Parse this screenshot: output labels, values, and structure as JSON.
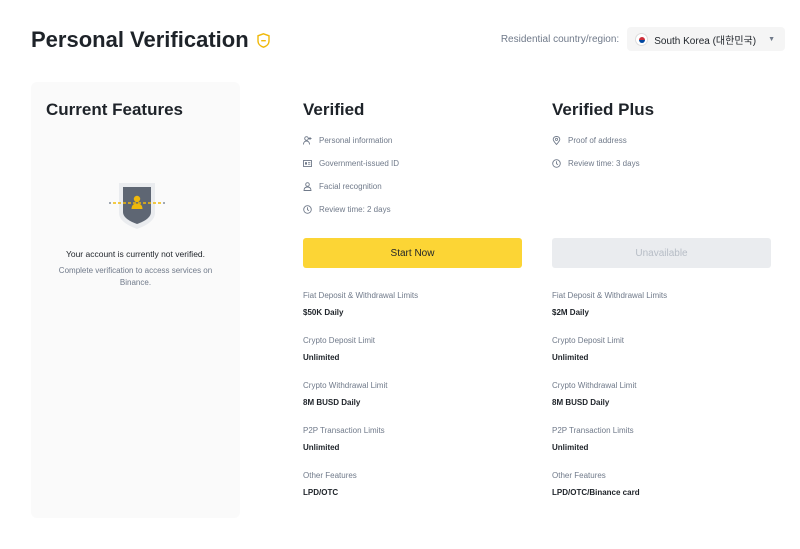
{
  "header": {
    "title": "Personal Verification",
    "region_label": "Residential country/region:",
    "region_value": "South Korea (대한민국)"
  },
  "current": {
    "title": "Current Features",
    "status": "Your account is currently not verified.",
    "description": "Complete verification to access services on Binance."
  },
  "verified": {
    "title": "Verified",
    "requirements": [
      {
        "icon": "person-icon",
        "text": "Personal information"
      },
      {
        "icon": "id-card-icon",
        "text": "Government-issued ID"
      },
      {
        "icon": "face-icon",
        "text": "Facial recognition"
      },
      {
        "icon": "clock-icon",
        "text": "Review time: 2 days"
      }
    ],
    "button_label": "Start Now",
    "limits": [
      {
        "label": "Fiat Deposit & Withdrawal Limits",
        "value": "$50K Daily"
      },
      {
        "label": "Crypto Deposit Limit",
        "value": "Unlimited"
      },
      {
        "label": "Crypto Withdrawal Limit",
        "value": "8M BUSD Daily"
      },
      {
        "label": "P2P Transaction Limits",
        "value": "Unlimited"
      },
      {
        "label": "Other Features",
        "value": "LPD/OTC"
      }
    ]
  },
  "plus": {
    "title": "Verified Plus",
    "requirements": [
      {
        "icon": "location-icon",
        "text": "Proof of address"
      },
      {
        "icon": "clock-icon",
        "text": "Review time: 3 days"
      }
    ],
    "button_label": "Unavailable",
    "limits": [
      {
        "label": "Fiat Deposit & Withdrawal Limits",
        "value": "$2M Daily"
      },
      {
        "label": "Crypto Deposit Limit",
        "value": "Unlimited"
      },
      {
        "label": "Crypto Withdrawal Limit",
        "value": "8M BUSD Daily"
      },
      {
        "label": "P2P Transaction Limits",
        "value": "Unlimited"
      },
      {
        "label": "Other Features",
        "value": "LPD/OTC/Binance card"
      }
    ]
  },
  "colors": {
    "accent": "#fcd535",
    "text_primary": "#1e2329",
    "text_secondary": "#707a8a",
    "disabled_bg": "#eaecef"
  }
}
